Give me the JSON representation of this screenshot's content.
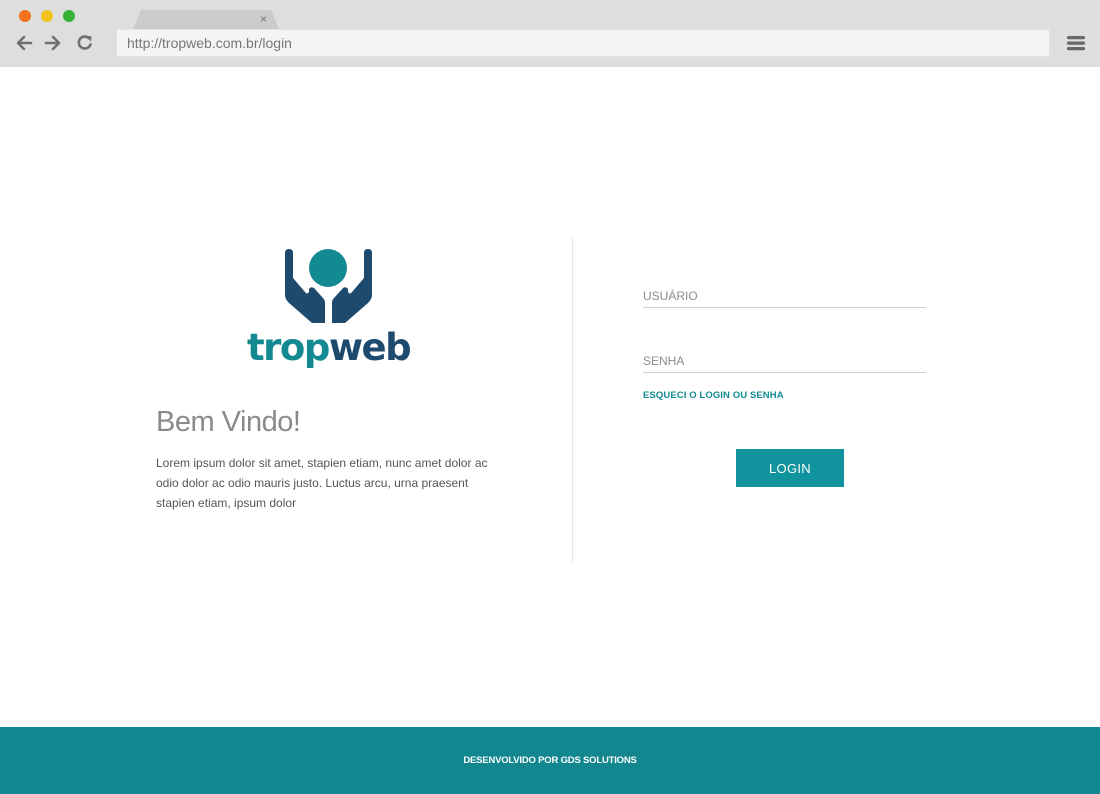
{
  "browser": {
    "url": "http://tropweb.com.br/login",
    "tab_close": "×",
    "icons": {
      "back": "back-arrow-icon",
      "forward": "forward-arrow-icon",
      "reload": "reload-icon",
      "menu": "hamburger-menu-icon",
      "close": "close-icon"
    },
    "colors": {
      "close_dot": "#f2711c",
      "minimize_dot": "#f2c31c",
      "maximize_dot": "#34b234"
    }
  },
  "logo": {
    "text_part1": "trop",
    "text_part2": "web",
    "colors": {
      "teal": "#138a91",
      "navy": "#1e4a6e"
    }
  },
  "welcome": {
    "title": "Bem Vindo!",
    "text": "Lorem ipsum dolor sit amet, stapien etiam, nunc amet dolor ac odio dolor ac odio mauris justo. Luctus arcu, urna praesent stapien etiam, ipsum dolor"
  },
  "login_form": {
    "username_placeholder": "USUÁRIO",
    "username_value": "",
    "password_placeholder": "SENHA",
    "password_value": "",
    "forgot_link": "ESQUECI O LOGIN OU SENHA",
    "submit_label": "LOGIN",
    "accent_color": "#11939e"
  },
  "footer": {
    "text": "DESENVOLVIDO POR GDS SOLUTIONS",
    "background": "#128790"
  }
}
